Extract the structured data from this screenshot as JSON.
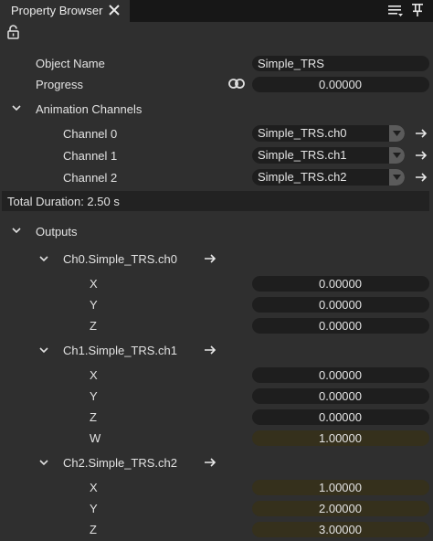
{
  "tab": {
    "title": "Property Browser",
    "close_icon": "close-icon"
  },
  "toolbar": {
    "menu_icon": "menu-filter-icon",
    "pin_icon": "pin-icon",
    "lock_icon": "unlocked-icon"
  },
  "properties": {
    "object_name_label": "Object Name",
    "object_name_value": "Simple_TRS",
    "progress_label": "Progress",
    "progress_value": "0.00000",
    "link_icon": "link-icon"
  },
  "animation_channels": {
    "header": "Animation Channels",
    "channels": [
      {
        "label": "Channel 0",
        "value": "Simple_TRS.ch0"
      },
      {
        "label": "Channel 1",
        "value": "Simple_TRS.ch1"
      },
      {
        "label": "Channel 2",
        "value": "Simple_TRS.ch2"
      }
    ]
  },
  "total_duration": "Total Duration: 2.50 s",
  "outputs": {
    "header": "Outputs",
    "groups": [
      {
        "name": "Ch0.Simple_TRS.ch0",
        "fields": [
          {
            "label": "X",
            "value": "0.00000",
            "keyed": false
          },
          {
            "label": "Y",
            "value": "0.00000",
            "keyed": false
          },
          {
            "label": "Z",
            "value": "0.00000",
            "keyed": false
          }
        ]
      },
      {
        "name": "Ch1.Simple_TRS.ch1",
        "fields": [
          {
            "label": "X",
            "value": "0.00000",
            "keyed": false
          },
          {
            "label": "Y",
            "value": "0.00000",
            "keyed": false
          },
          {
            "label": "Z",
            "value": "0.00000",
            "keyed": false
          },
          {
            "label": "W",
            "value": "1.00000",
            "keyed": true
          }
        ]
      },
      {
        "name": "Ch2.Simple_TRS.ch2",
        "fields": [
          {
            "label": "X",
            "value": "1.00000",
            "keyed": true
          },
          {
            "label": "Y",
            "value": "2.00000",
            "keyed": true
          },
          {
            "label": "Z",
            "value": "3.00000",
            "keyed": true
          }
        ]
      }
    ]
  },
  "colors": {
    "background": "#2f2f2f",
    "field": "#1e1e1e",
    "keyed_field": "#35301c",
    "tab_bar": "#171717"
  }
}
